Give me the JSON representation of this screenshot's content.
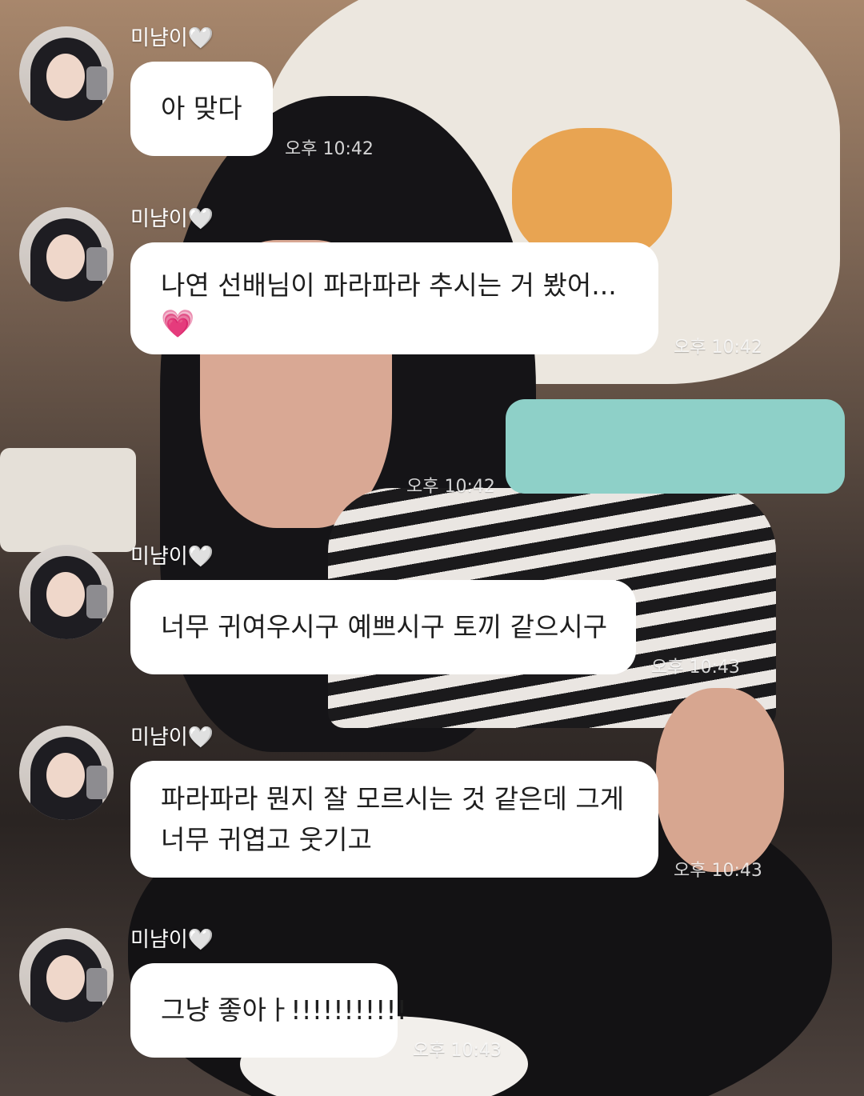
{
  "accent_colors": {
    "bubble_incoming": "#ffffff",
    "bubble_outgoing": "#8ed0c8",
    "emoji_heart": "#ff4fd3"
  },
  "messages": [
    {
      "sender": "미냠이",
      "sender_heart": "🤍",
      "lines": [
        "아 맞다"
      ],
      "time": "오후 10:42"
    },
    {
      "sender": "미냠이",
      "sender_heart": "🤍",
      "lines": [
        "나연 선배님이 파라파라 추시는 거 봤어..."
      ],
      "emoji": "💗",
      "time": "오후 10:42"
    },
    {
      "outgoing": true,
      "time": "오후 10:42"
    },
    {
      "sender": "미냠이",
      "sender_heart": "🤍",
      "lines": [
        "너무 귀여우시구 예쁘시구 토끼 같으시구"
      ],
      "time": "오후 10:43"
    },
    {
      "sender": "미냠이",
      "sender_heart": "🤍",
      "lines": [
        "파라파라 뭔지 잘 모르시는 것 같은데 그게",
        "너무 귀엽고 웃기고"
      ],
      "time": "오후 10:43"
    },
    {
      "sender": "미냠이",
      "sender_heart": "🤍",
      "lines": [
        "그냥 좋아ㅏ!!!!!!!!!!!"
      ],
      "time": "오후 10:43"
    }
  ]
}
